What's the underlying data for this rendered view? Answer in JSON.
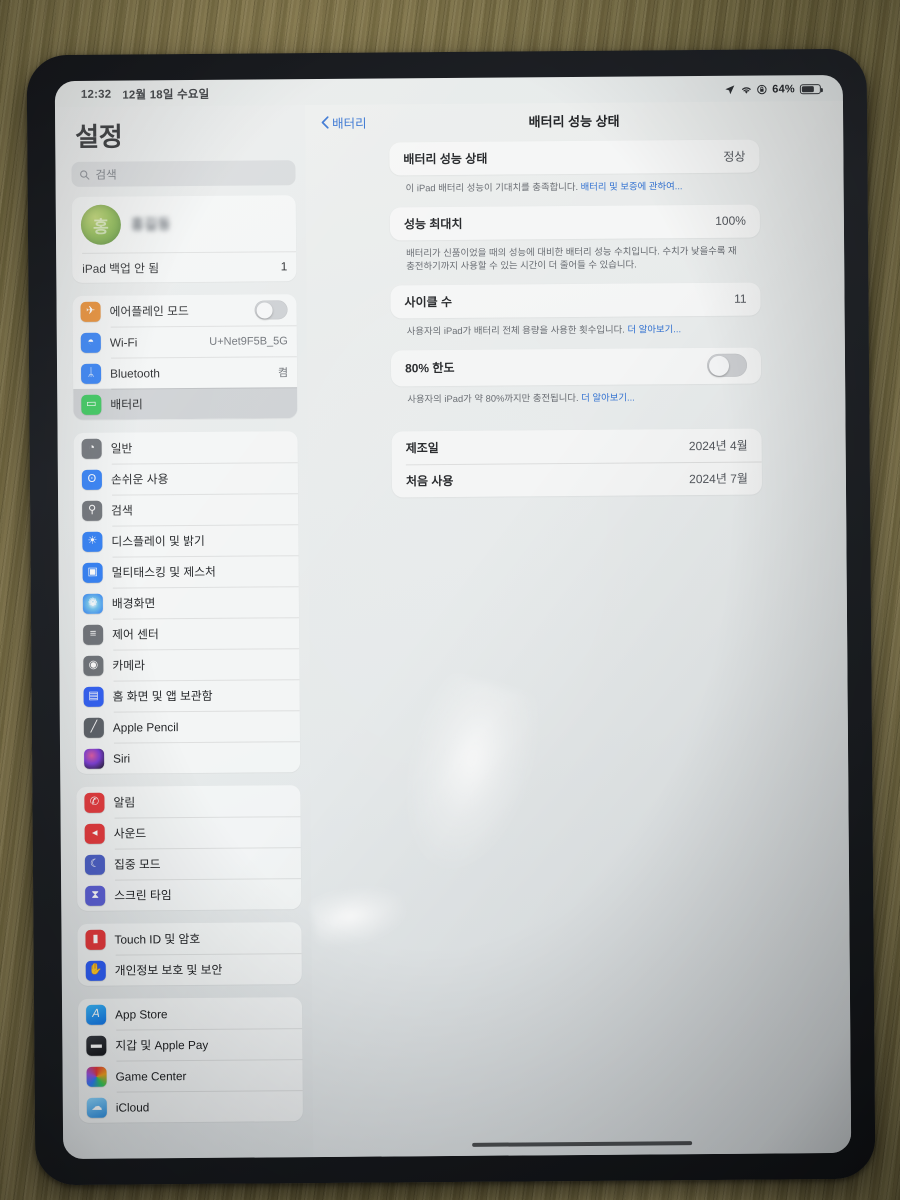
{
  "status_bar": {
    "time": "12:32",
    "date": "12월 18일 수요일",
    "location_icon": "location-arrow-icon",
    "wifi_icon": "wifi-icon",
    "orientation_lock_icon": "rotation-lock-icon",
    "battery_percent": "64%",
    "battery_icon": "battery-icon"
  },
  "sidebar": {
    "title": "설정",
    "search": {
      "placeholder": "검색",
      "icon": "search-icon"
    },
    "account": {
      "name": "홍길동",
      "avatar_icon": "avatar",
      "backup_label": "iPad 백업 안 됨",
      "backup_badge": "1"
    },
    "groups": [
      {
        "items": [
          {
            "label": "에어플레인 모드",
            "icon": "airplane-icon",
            "icon_color": "#e8892b",
            "control": "switch",
            "switch_on": false
          },
          {
            "label": "Wi-Fi",
            "icon": "wifi-icon",
            "icon_color": "#2d7df6",
            "value": "U+Net9F5B_5G"
          },
          {
            "label": "Bluetooth",
            "icon": "bluetooth-icon",
            "icon_color": "#2d7df6",
            "value": "켬"
          },
          {
            "label": "배터리",
            "icon": "battery-icon",
            "icon_color": "#35c759",
            "selected": true
          }
        ]
      },
      {
        "items": [
          {
            "label": "일반",
            "icon": "gear-icon",
            "icon_color": "#6c7076"
          },
          {
            "label": "손쉬운 사용",
            "icon": "accessibility-icon",
            "icon_color": "#2d7df6"
          },
          {
            "label": "검색",
            "icon": "search-icon",
            "icon_color": "#6c7076"
          },
          {
            "label": "디스플레이 및 밝기",
            "icon": "brightness-icon",
            "icon_color": "#2d7df6"
          },
          {
            "label": "멀티태스킹 및 제스처",
            "icon": "multitasking-icon",
            "icon_color": "#2d7df6"
          },
          {
            "label": "배경화면",
            "icon": "wallpaper-icon",
            "icon_color": "#3aa5e8"
          },
          {
            "label": "제어 센터",
            "icon": "control-center-icon",
            "icon_color": "#6c7076"
          },
          {
            "label": "카메라",
            "icon": "camera-icon",
            "icon_color": "#6c7076"
          },
          {
            "label": "홈 화면 및 앱 보관함",
            "icon": "home-screen-icon",
            "icon_color": "#2d5df6"
          },
          {
            "label": "Apple Pencil",
            "icon": "pencil-icon",
            "icon_color": "#5a5f66"
          },
          {
            "label": "Siri",
            "icon": "siri-icon",
            "icon_color": "#2a2d33"
          }
        ]
      },
      {
        "items": [
          {
            "label": "알림",
            "icon": "bell-icon",
            "icon_color": "#e5383b"
          },
          {
            "label": "사운드",
            "icon": "speaker-icon",
            "icon_color": "#e5383b"
          },
          {
            "label": "집중 모드",
            "icon": "moon-icon",
            "icon_color": "#4b5fc7"
          },
          {
            "label": "스크린 타임",
            "icon": "hourglass-icon",
            "icon_color": "#5b5fd6"
          }
        ]
      },
      {
        "items": [
          {
            "label": "Touch ID 및 암호",
            "icon": "lock-icon",
            "icon_color": "#e5383b"
          },
          {
            "label": "개인정보 보호 및 보안",
            "icon": "hand-icon",
            "icon_color": "#2d5df6"
          }
        ]
      },
      {
        "items": [
          {
            "label": "App Store",
            "icon": "app-store-icon",
            "icon_color": "#1f9cf0"
          },
          {
            "label": "지갑 및 Apple Pay",
            "icon": "wallet-icon",
            "icon_color": "#2a2d33"
          },
          {
            "label": "Game Center",
            "icon": "game-center-icon",
            "icon_color": "#f0f0f2"
          },
          {
            "label": "iCloud",
            "icon": "icloud-icon",
            "icon_color": "#3aa5e8"
          }
        ]
      }
    ]
  },
  "detail": {
    "back_label": "배터리",
    "back_icon": "chevron-left-icon",
    "title": "배터리 성능 상태",
    "sections": [
      {
        "rows": [
          {
            "title": "배터리 성능 상태",
            "value": "정상"
          }
        ],
        "footnote": "이 iPad 배터리 성능이 기대치를 충족합니다. ",
        "footnote_link": "배터리 및 보증에 관하여..."
      },
      {
        "rows": [
          {
            "title": "성능 최대치",
            "value": "100%"
          }
        ],
        "footnote": "배터리가 신품이었을 때의 성능에 대비한 배터리 성능 수치입니다. 수치가 낮을수록 재충전하기까지 사용할 수 있는 시간이 더 줄어들 수 있습니다.",
        "footnote_link": ""
      },
      {
        "rows": [
          {
            "title": "사이클 수",
            "value": "11"
          }
        ],
        "footnote": "사용자의 iPad가 배터리 전체 용량을 사용한 횟수입니다. ",
        "footnote_link": "더 알아보기..."
      },
      {
        "rows": [
          {
            "title": "80% 한도",
            "value": "",
            "control": "switch",
            "switch_on": false
          }
        ],
        "footnote": "사용자의 iPad가 약 80%까지만 충전됩니다. ",
        "footnote_link": "더 알아보기..."
      }
    ],
    "info_card": {
      "rows": [
        {
          "title": "제조일",
          "value": "2024년 4월"
        },
        {
          "title": "처음 사용",
          "value": "2024년 7월"
        }
      ]
    }
  },
  "home_indicator": "home-indicator",
  "colors": {
    "accent_blue": "#2f6fd0",
    "badge_red": "#e5383b",
    "switch_green": "#34c759",
    "battery_green": "#35c759"
  }
}
